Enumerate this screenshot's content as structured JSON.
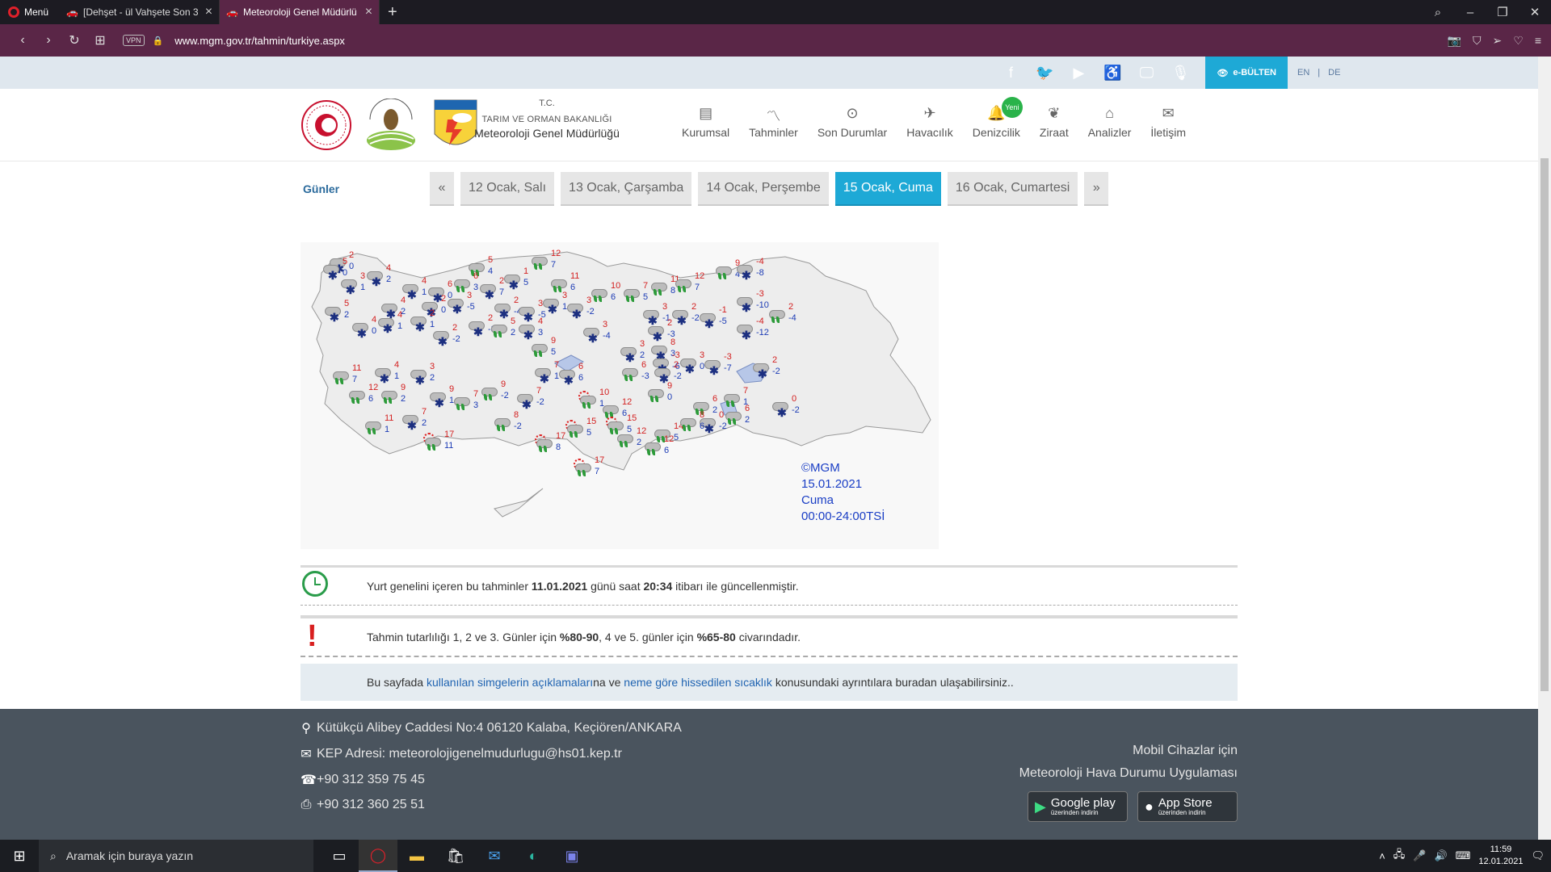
{
  "browser": {
    "menu_label": "Menü",
    "tabs": [
      {
        "title": "[Dehşet - ül Vahşete Son 3"
      },
      {
        "title": "Meteoroloji Genel Müdürlü"
      }
    ],
    "url": "www.mgm.gov.tr/tahmin/turkiye.aspx",
    "vpn_label": "VPN"
  },
  "topstrip": {
    "ebulten": "e-BÜLTEN",
    "lang_en": "EN",
    "lang_de": "DE"
  },
  "header": {
    "tc": "T.C.",
    "ministry": "TARIM VE ORMAN BAKANLIĞI",
    "agency": "Meteoroloji Genel Müdürlüğü",
    "nav": [
      {
        "label": "Kurumsal",
        "icon": "document-icon"
      },
      {
        "label": "Tahminler",
        "icon": "chart-icon"
      },
      {
        "label": "Son Durumlar",
        "icon": "check-circle-icon"
      },
      {
        "label": "Havacılık",
        "icon": "plane-icon"
      },
      {
        "label": "Denizcilik",
        "icon": "bell-icon"
      },
      {
        "label": "Ziraat",
        "icon": "leaf-icon"
      },
      {
        "label": "Analizler",
        "icon": "search-house-icon"
      },
      {
        "label": "İletişim",
        "icon": "mail-icon"
      }
    ],
    "new_badge": "Yeni"
  },
  "days": {
    "label": "Günler",
    "prev": "«",
    "next": "»",
    "items": [
      "12 Ocak, Salı",
      "13 Ocak, Çarşamba",
      "14 Ocak, Perşembe",
      "15 Ocak, Cuma",
      "16 Ocak, Cumartesi"
    ],
    "active_index": 3
  },
  "map": {
    "stamp_1": "©MGM",
    "stamp_2": "15.01.2021",
    "stamp_3": "Cuma",
    "stamp_4": "00:00-24:00TSİ",
    "stations": [
      {
        "hi": "2",
        "lo": "0",
        "w": "s"
      },
      {
        "hi": "5",
        "lo": "0",
        "w": "s"
      },
      {
        "hi": "4",
        "lo": "2",
        "w": "s"
      },
      {
        "hi": "3",
        "lo": "1",
        "w": "s"
      },
      {
        "hi": "4",
        "lo": "1",
        "w": "s"
      },
      {
        "hi": "6",
        "lo": "0",
        "w": "s"
      },
      {
        "hi": "5",
        "lo": "4",
        "w": "r"
      },
      {
        "hi": "12",
        "lo": "7",
        "w": "r"
      },
      {
        "hi": "6",
        "lo": "3",
        "w": "r"
      },
      {
        "hi": "2",
        "lo": "7",
        "w": "s"
      },
      {
        "hi": "1",
        "lo": "5",
        "w": "s"
      },
      {
        "hi": "11",
        "lo": "6",
        "w": "r"
      },
      {
        "hi": "10",
        "lo": "6",
        "w": "r"
      },
      {
        "hi": "7",
        "lo": "5",
        "w": "r"
      },
      {
        "hi": "11",
        "lo": "8",
        "w": "r"
      },
      {
        "hi": "12",
        "lo": "7",
        "w": "r"
      },
      {
        "hi": "9",
        "lo": "4",
        "w": "r"
      },
      {
        "hi": "-4",
        "lo": "-8",
        "w": "s"
      },
      {
        "hi": "5",
        "lo": "2",
        "w": "s"
      },
      {
        "hi": "4",
        "lo": "2",
        "w": "s"
      },
      {
        "hi": "2",
        "lo": "0",
        "w": "s"
      },
      {
        "hi": "3",
        "lo": "-5",
        "w": "s"
      },
      {
        "hi": "2",
        "lo": "-4",
        "w": "s"
      },
      {
        "hi": "3",
        "lo": "-5",
        "w": "s"
      },
      {
        "hi": "3",
        "lo": "1",
        "w": "s"
      },
      {
        "hi": "3",
        "lo": "-2",
        "w": "s"
      },
      {
        "hi": "3",
        "lo": "-1",
        "w": "s"
      },
      {
        "hi": "2",
        "lo": "-2",
        "w": "s"
      },
      {
        "hi": "-1",
        "lo": "-5",
        "w": "s"
      },
      {
        "hi": "-3",
        "lo": "-10",
        "w": "s"
      },
      {
        "hi": "2",
        "lo": "-4",
        "w": "r"
      },
      {
        "hi": "4",
        "lo": "0",
        "w": "s"
      },
      {
        "hi": "4",
        "lo": "1",
        "w": "s"
      },
      {
        "hi": "2",
        "lo": "1",
        "w": "s"
      },
      {
        "hi": "2",
        "lo": "-2",
        "w": "s"
      },
      {
        "hi": "2",
        "lo": "-3",
        "w": "s"
      },
      {
        "hi": "5",
        "lo": "2",
        "w": "r"
      },
      {
        "hi": "4",
        "lo": "3",
        "w": "s"
      },
      {
        "hi": "3",
        "lo": "-4",
        "w": "s"
      },
      {
        "hi": "2",
        "lo": "-3",
        "w": "s"
      },
      {
        "hi": "-4",
        "lo": "-12",
        "w": "s"
      },
      {
        "hi": "9",
        "lo": "5",
        "w": "r"
      },
      {
        "hi": "3",
        "lo": "2",
        "w": "s"
      },
      {
        "hi": "8",
        "lo": "3",
        "w": "s"
      },
      {
        "hi": "-3",
        "lo": "-6",
        "w": "s"
      },
      {
        "hi": "3",
        "lo": "0",
        "w": "s"
      },
      {
        "hi": "-3",
        "lo": "-7",
        "w": "s"
      },
      {
        "hi": "2",
        "lo": "-2",
        "w": "s"
      },
      {
        "hi": "11",
        "lo": "7",
        "w": "r"
      },
      {
        "hi": "4",
        "lo": "1",
        "w": "s"
      },
      {
        "hi": "3",
        "lo": "2",
        "w": "s"
      },
      {
        "hi": "7",
        "lo": "1",
        "w": "s"
      },
      {
        "hi": "6",
        "lo": "6",
        "w": "s"
      },
      {
        "hi": "6",
        "lo": "-3",
        "w": "r"
      },
      {
        "hi": "2",
        "lo": "-2",
        "w": "s"
      },
      {
        "hi": "0",
        "lo": "-2",
        "w": "s"
      },
      {
        "hi": "12",
        "lo": "6",
        "w": "r"
      },
      {
        "hi": "9",
        "lo": "2",
        "w": "r"
      },
      {
        "hi": "9",
        "lo": "1",
        "w": "s"
      },
      {
        "hi": "9",
        "lo": "-2",
        "w": "r"
      },
      {
        "hi": "7",
        "lo": "-2",
        "w": "s"
      },
      {
        "hi": "7",
        "lo": "3",
        "w": "r"
      },
      {
        "hi": "10",
        "lo": "1",
        "w": "u"
      },
      {
        "hi": "12",
        "lo": "6",
        "w": "r"
      },
      {
        "hi": "9",
        "lo": "0",
        "w": "r"
      },
      {
        "hi": "6",
        "lo": "2",
        "w": "r"
      },
      {
        "hi": "7",
        "lo": "1",
        "w": "r"
      },
      {
        "hi": "6",
        "lo": "2",
        "w": "r"
      },
      {
        "hi": "0",
        "lo": "-2",
        "w": "s"
      },
      {
        "hi": "11",
        "lo": "1",
        "w": "r"
      },
      {
        "hi": "7",
        "lo": "2",
        "w": "s"
      },
      {
        "hi": "17",
        "lo": "11",
        "w": "u"
      },
      {
        "hi": "8",
        "lo": "-2",
        "w": "r"
      },
      {
        "hi": "17",
        "lo": "8",
        "w": "u"
      },
      {
        "hi": "15",
        "lo": "5",
        "w": "u"
      },
      {
        "hi": "15",
        "lo": "5",
        "w": "u"
      },
      {
        "hi": "12",
        "lo": "2",
        "w": "r"
      },
      {
        "hi": "14",
        "lo": "5",
        "w": "r"
      },
      {
        "hi": "8",
        "lo": "6",
        "w": "r"
      },
      {
        "hi": "12",
        "lo": "6",
        "w": "r"
      },
      {
        "hi": "17",
        "lo": "7",
        "w": "u"
      }
    ]
  },
  "info": {
    "update_pre": "Yurt genelini içeren bu tahminler ",
    "update_date": "11.01.2021",
    "update_mid": " günü saat ",
    "update_time": "20:34",
    "update_post": " itibarı ile güncellenmiştir.",
    "acc_pre": "Tahmin tutarlılığı 1, 2 ve 3. Günler için ",
    "acc_1": "%80-90",
    "acc_mid": ", 4 ve 5. günler için ",
    "acc_2": "%65-80",
    "acc_post": " civarındadır.",
    "links_pre": "Bu sayfada ",
    "link_symbols": "kullanılan simgelerin açıklamaları",
    "links_mid": "na ve ",
    "link_feels": "neme göre hissedilen sıcaklık",
    "links_post": " konusundaki ayrıntılara buradan ulaşabilirsiniz.."
  },
  "footer": {
    "address": "Kütükçü Alibey Caddesi No:4 06120 Kalaba, Keçiören/ANKARA",
    "kep": "KEP Adresi: meteorolojigenelmudurlugu@hs01.kep.tr",
    "phone": "+90 312 359 75 45",
    "fax": "+90 312 360 25 51",
    "mobile_1": "Mobil Cihazlar için",
    "mobile_2": "Meteoroloji Hava Durumu Uygulaması",
    "google_name": "Google play",
    "google_sub": "üzerinden indirin",
    "apple_name": "App Store",
    "apple_sub": "üzerinden indirin"
  },
  "taskbar": {
    "search_placeholder": "Aramak için buraya yazın",
    "time": "11:59",
    "date": "12.01.2021"
  }
}
